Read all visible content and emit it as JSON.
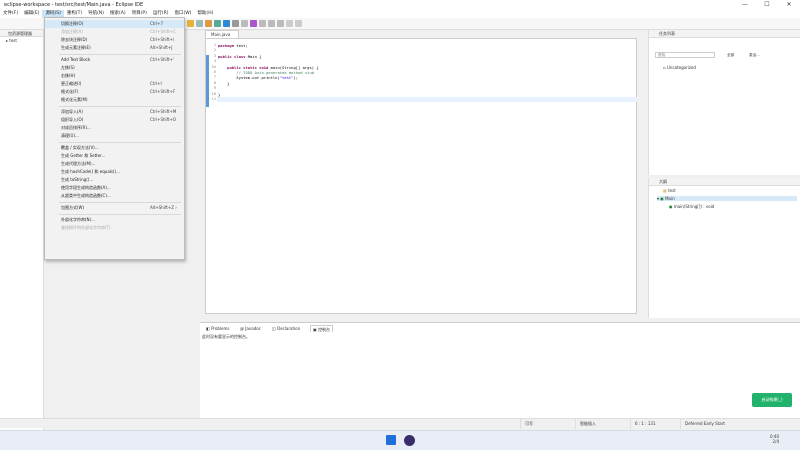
{
  "window": {
    "title": "eclipse-workspace - test/src/test/Main.java - Eclipse IDE"
  },
  "menubar": {
    "items": [
      {
        "label": "文件(F)"
      },
      {
        "label": "编辑(E)"
      },
      {
        "label": "源码(S)"
      },
      {
        "label": "重构(T)"
      },
      {
        "label": "导航(N)"
      },
      {
        "label": "搜索(A)"
      },
      {
        "label": "项目(P)"
      },
      {
        "label": "运行(R)"
      },
      {
        "label": "窗口(W)"
      },
      {
        "label": "帮助(H)"
      }
    ]
  },
  "left_panel": {
    "title": "包资源管理器",
    "tree_item": "test"
  },
  "source_menu": {
    "items": [
      {
        "label": "切换注释(O)",
        "shortcut": "Ctrl+7",
        "dim": false
      },
      {
        "label": "添加注释(A)",
        "shortcut": "Ctrl+Shift+C",
        "dim": true
      },
      {
        "label": "除去块注释(D)",
        "shortcut": "Ctrl+Shift+\\",
        "dim": false
      },
      {
        "label": "生成元素注释(E)",
        "shortcut": "Alt+Shift+J",
        "dim": false
      },
      {
        "sep": true
      },
      {
        "label": "Add Text Block",
        "shortcut": "Ctrl+Shift+'",
        "dim": false
      },
      {
        "label": "左移(S)",
        "shortcut": "",
        "dim": false
      },
      {
        "label": "右移(H)",
        "shortcut": "",
        "dim": false
      },
      {
        "label": "更正缩进(I)",
        "shortcut": "Ctrl+I",
        "dim": false
      },
      {
        "label": "格式化(F)",
        "shortcut": "Ctrl+Shift+F",
        "dim": false
      },
      {
        "label": "格式化元素(M)",
        "shortcut": "",
        "dim": false
      },
      {
        "sep": true
      },
      {
        "label": "添加导入(A)",
        "shortcut": "Ctrl+Shift+M",
        "dim": false
      },
      {
        "label": "组织导入(O)",
        "shortcut": "Ctrl+Shift+O",
        "dim": false
      },
      {
        "label": "对成员排序(R)...",
        "shortcut": "",
        "dim": false
      },
      {
        "label": "清理(U)...",
        "shortcut": "",
        "dim": false
      },
      {
        "sep": true
      },
      {
        "label": "覆盖 / 实现方法(V)...",
        "shortcut": "",
        "dim": false
      },
      {
        "label": "生成 Getter 和 Setter...",
        "shortcut": "",
        "dim": false
      },
      {
        "label": "生成代理方法(M)...",
        "shortcut": "",
        "dim": false
      },
      {
        "label": "生成 hashCode() 和 equals()...",
        "shortcut": "",
        "dim": false
      },
      {
        "label": "生成 toString()...",
        "shortcut": "",
        "dim": false
      },
      {
        "label": "使用字段生成构造函数(A)...",
        "shortcut": "",
        "dim": false
      },
      {
        "label": "从超类中生成构造函数(C)...",
        "shortcut": "",
        "dim": false
      },
      {
        "sep": true
      },
      {
        "label": "包围方式(W)",
        "shortcut": "Alt+Shift+Z ›",
        "dim": false
      },
      {
        "sep": true
      },
      {
        "label": "外部化字符串(N)...",
        "shortcut": "",
        "dim": false
      },
      {
        "label": "查找损坏的外部化字符串(T)",
        "shortcut": "",
        "dim": true
      }
    ]
  },
  "editor": {
    "tab": "Main.java",
    "lines": [
      {
        "n": "1",
        "html": "<span class='kw'>package</span> test;"
      },
      {
        "n": "2",
        "html": ""
      },
      {
        "n": "3",
        "html": "<span class='kw'>public class</span> Main {"
      },
      {
        "n": "4",
        "html": ""
      },
      {
        "n": "5⊖",
        "html": "    <span class='kw'>public static void</span> main(String[] args) {"
      },
      {
        "n": "6",
        "html": "        <span class='cm'>// TODO Auto-generated method stub</span>"
      },
      {
        "n": "7",
        "html": "        System.<i>out</i>.println(<span class='st'>\"test\"</span>);"
      },
      {
        "n": "8",
        "html": "    }"
      },
      {
        "n": "9",
        "html": ""
      },
      {
        "n": "10",
        "html": "}"
      },
      {
        "n": "11",
        "html": ""
      }
    ]
  },
  "bottom_panel": {
    "tabs": [
      "Problems",
      "Javadoc",
      "Declaration",
      "控制台"
    ],
    "message": "此时没有要显示的控制台。"
  },
  "right_top": {
    "title": "任务列表",
    "find_placeholder": "查找",
    "all_label": "全部",
    "activate_label": "激活...",
    "category": "Uncategorized"
  },
  "right_bottom": {
    "title": "大纲",
    "items": [
      "test",
      "Main",
      "main(String[]) : void"
    ]
  },
  "status": {
    "writable": "可写",
    "insert_mode": "智能插入",
    "position": "6 : 1 : 131",
    "task": "Deferred Early Start"
  },
  "green_button": "启动构建(_)",
  "taskbar": {
    "time": "0:40",
    "date": "2/4"
  },
  "colors": {
    "accent": "#21b36b",
    "menu_highlight": "#d6e9f8"
  }
}
